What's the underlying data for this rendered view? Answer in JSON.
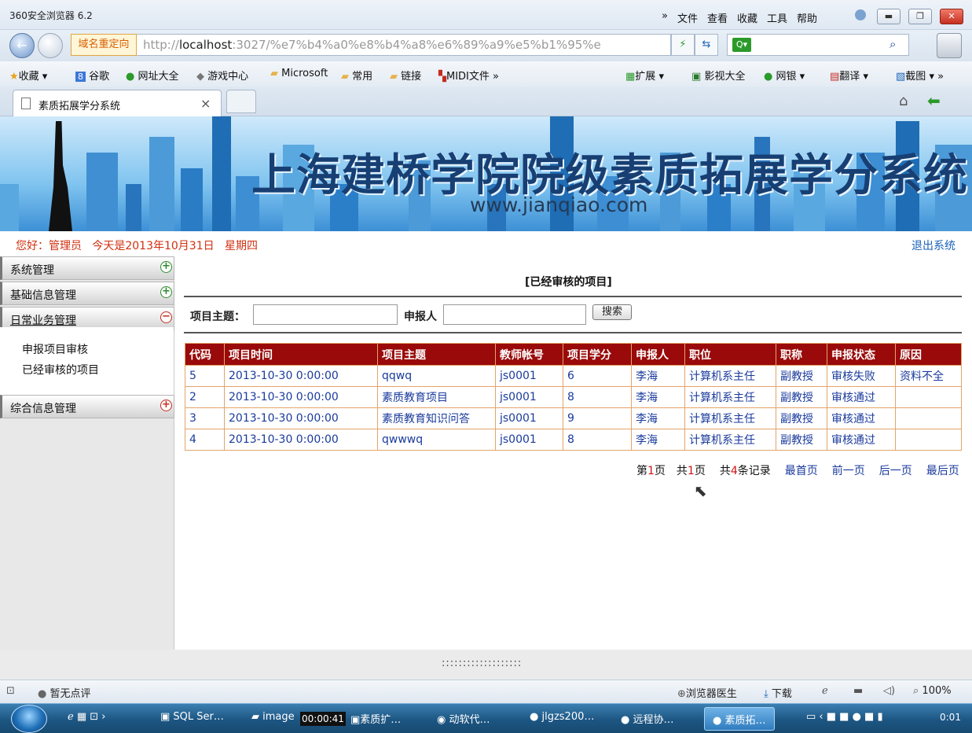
{
  "browser": {
    "title": "360安全浏览器 6.2",
    "menu": [
      "»",
      "文件",
      "查看",
      "收藏",
      "工具",
      "帮助"
    ],
    "redirect_label": "域名重定向",
    "url_prefix": "http://",
    "url_host": "localhost",
    "url_rest": ":3027/%e7%b4%a0%e8%b4%a8%e6%89%a9%e5%b1%95%e",
    "search_placeholder": "",
    "bookmarks": [
      "收藏",
      "谷歌",
      "网址大全",
      "游戏中心",
      "Microsoft",
      "常用",
      "链接",
      "MIDI文件",
      "»"
    ],
    "bookmarks_right": [
      "扩展",
      "影视大全",
      "网银",
      "翻译",
      "截图",
      "»"
    ],
    "tab_title": "素质拓展学分系统",
    "tab_close": "×"
  },
  "banner": {
    "title": "上海建桥学院院级素质拓展学分系统",
    "url": "www.jianqiao.com"
  },
  "header": {
    "greeting": "您好：管理员   今天是2013年10月31日   星期四",
    "logout": "退出系统"
  },
  "sidebar": {
    "sections": [
      {
        "label": "系统管理",
        "toggle": "+"
      },
      {
        "label": "基础信息管理",
        "toggle": "+"
      },
      {
        "label": "日常业务管理",
        "toggle": "−"
      },
      {
        "label": "综合信息管理",
        "toggle": "+"
      }
    ],
    "sub_items": [
      "申报项目审核",
      "已经审核的项目"
    ]
  },
  "content": {
    "title": "[已经审核的项目]",
    "search": {
      "topic_label": "项目主题：",
      "person_label": "申报人",
      "button": "搜索",
      "topic_value": "",
      "person_value": ""
    },
    "table": {
      "headers": [
        "代码",
        "项目时间",
        "项目主题",
        "教师帐号",
        "项目学分",
        "申报人",
        "职位",
        "职称",
        "申报状态",
        "原因"
      ],
      "rows": [
        [
          "5",
          "2013-10-30 0:00:00",
          "qqwq",
          "js0001",
          "6",
          "李海",
          "计算机系主任",
          "副教授",
          "审核失败",
          "资料不全"
        ],
        [
          "2",
          "2013-10-30 0:00:00",
          "素质教育项目",
          "js0001",
          "8",
          "李海",
          "计算机系主任",
          "副教授",
          "审核通过",
          ""
        ],
        [
          "3",
          "2013-10-30 0:00:00",
          "素质教育知识问答",
          "js0001",
          "9",
          "李海",
          "计算机系主任",
          "副教授",
          "审核通过",
          ""
        ],
        [
          "4",
          "2013-10-30 0:00:00",
          "qwwwq",
          "js0001",
          "8",
          "李海",
          "计算机系主任",
          "副教授",
          "审核通过",
          ""
        ]
      ]
    },
    "pager": {
      "page_prefix": "第",
      "page_num": "1",
      "page_suffix": "页",
      "total_prefix": "共",
      "total_pages": "1",
      "total_suffix": "页",
      "records_prefix": "共",
      "records_num": "4",
      "records_suffix": "条记录",
      "first": "最首页",
      "prev": "前一页",
      "next": "后一页",
      "last": "最后页"
    },
    "footer_dots": ":::::::::::::::::::"
  },
  "statusbar": {
    "rating": "暂无点评",
    "doctor": "浏览器医生",
    "download": "下载",
    "zoom": "100%"
  },
  "taskbar": {
    "items": [
      "SQL Ser…",
      "image",
      "素质扩…",
      "动软代…",
      "jlgzs200…",
      "远程协…",
      "素质拓…"
    ],
    "timer": "00:00:41",
    "clock": "0:01"
  }
}
